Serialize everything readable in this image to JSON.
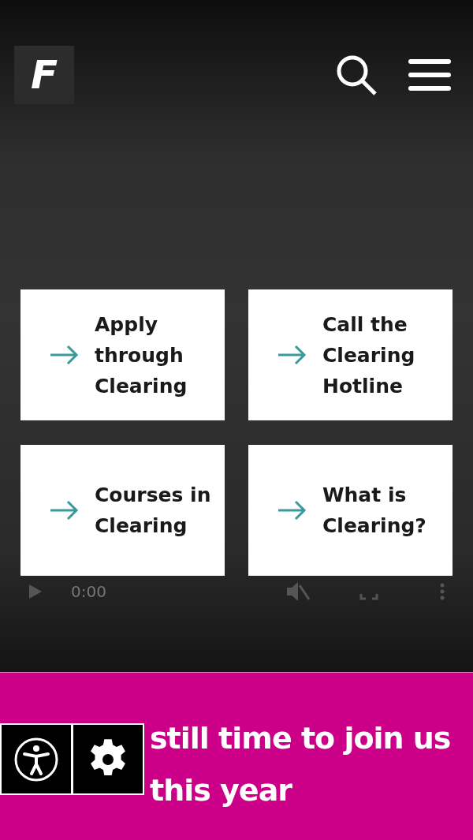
{
  "header": {
    "logo": "F"
  },
  "links": [
    {
      "label": "Apply through Clearing"
    },
    {
      "label": "Call the Clearing Hotline"
    },
    {
      "label": "Courses in Clearing"
    },
    {
      "label": "What is Clearing?"
    }
  ],
  "video_controls": {
    "time": "0:00",
    "muted": true
  },
  "banner": {
    "heading": "still time to join us this year"
  }
}
